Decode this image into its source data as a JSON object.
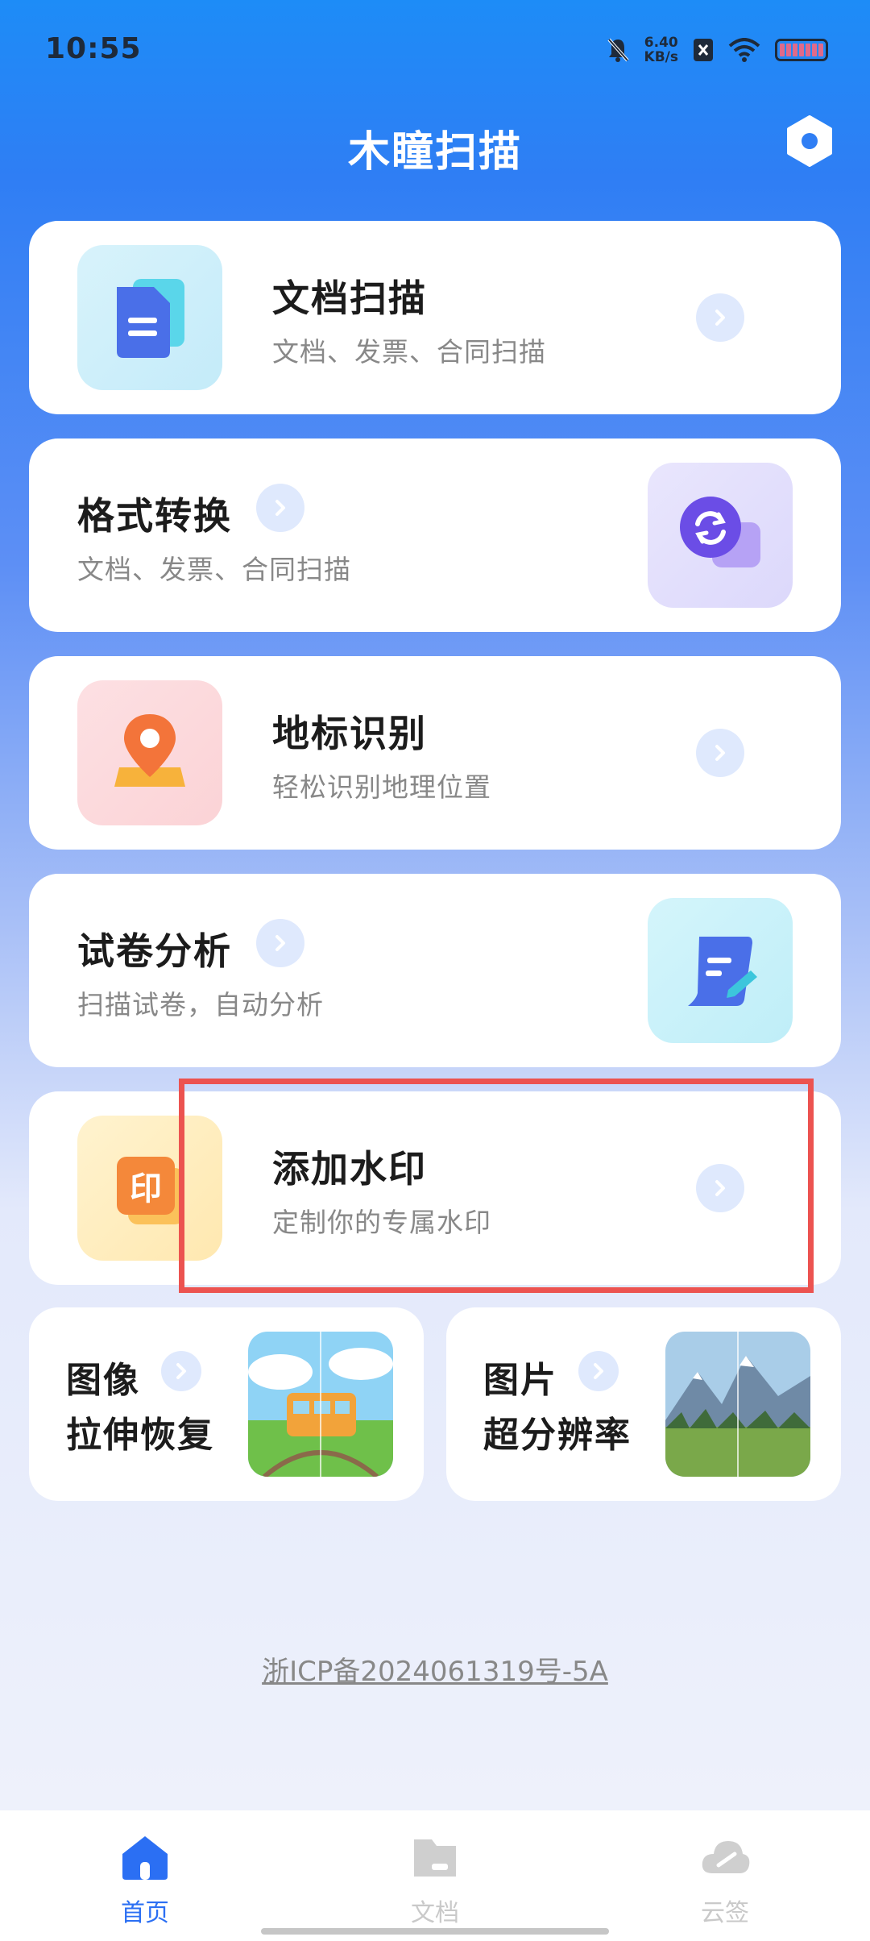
{
  "status_bar": {
    "time": "10:55",
    "net_speed": "6.40",
    "net_unit": "KB/s"
  },
  "header": {
    "title": "木瞳扫描",
    "settings_icon": "hexagon-settings-icon"
  },
  "cards": {
    "doc_scan": {
      "title": "文档扫描",
      "subtitle": "文档、发票、合同扫描"
    },
    "format_convert": {
      "title": "格式转换",
      "subtitle": "文档、发票、合同扫描"
    },
    "landmark": {
      "title": "地标识别",
      "subtitle": "轻松识别地理位置"
    },
    "exam": {
      "title": "试卷分析",
      "subtitle": "扫描试卷，自动分析"
    },
    "watermark": {
      "title": "添加水印",
      "subtitle": "定制你的专属水印",
      "icon_text": "印"
    }
  },
  "half_cards": {
    "stretch": {
      "line1": "图像",
      "line2": "拉伸恢复"
    },
    "superres": {
      "line1": "图片",
      "line2": "超分辨率"
    }
  },
  "footer": {
    "icp": "浙ICP备2024061319号-5A"
  },
  "tabbar": {
    "home": {
      "label": "首页",
      "color": "#2b6ff3"
    },
    "docs": {
      "label": "文档",
      "color": "#c9c9c9"
    },
    "cloud": {
      "label": "云签",
      "color": "#c9c9c9"
    }
  },
  "colors": {
    "accent": "#2b6ff3",
    "highlight": "#ec5350"
  }
}
